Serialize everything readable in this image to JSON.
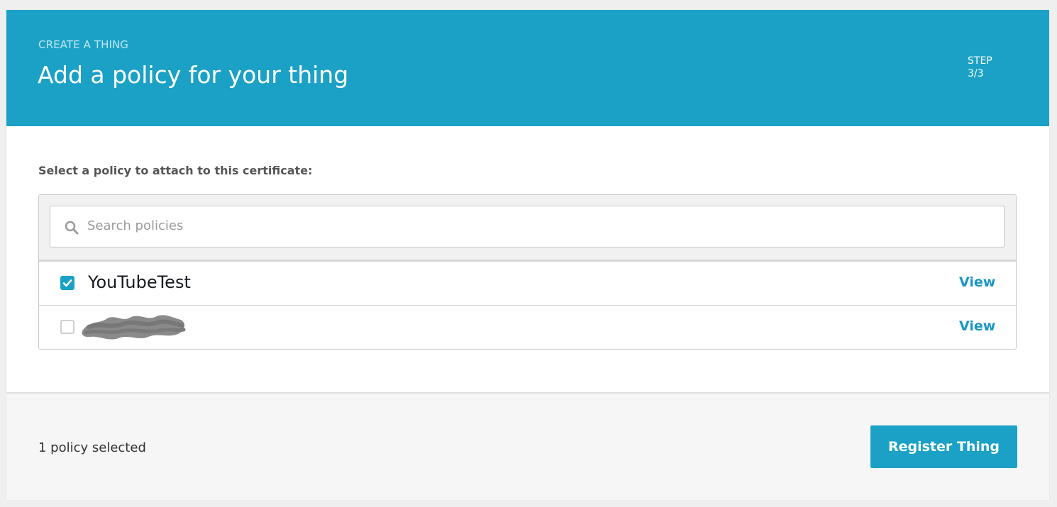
{
  "header": {
    "eyebrow": "CREATE A THING",
    "title": "Add a policy for your thing",
    "step_label": "STEP",
    "step_value": "3/3"
  },
  "content": {
    "prompt": "Select a policy to attach to this certificate:"
  },
  "search": {
    "placeholder": "Search policies",
    "value": ""
  },
  "policies": [
    {
      "name": "YouTubeTest",
      "checked": true,
      "view_label": "View"
    },
    {
      "name": "",
      "checked": false,
      "redacted": true,
      "view_label": "View"
    }
  ],
  "footer": {
    "selected_count": "1 policy selected",
    "register_label": "Register Thing"
  },
  "colors": {
    "accent": "#1ba1c6",
    "link": "#1b96c6",
    "background": "#efefef"
  },
  "icons": {
    "search": "search-icon",
    "checkbox_checked": "checkmark-icon"
  }
}
